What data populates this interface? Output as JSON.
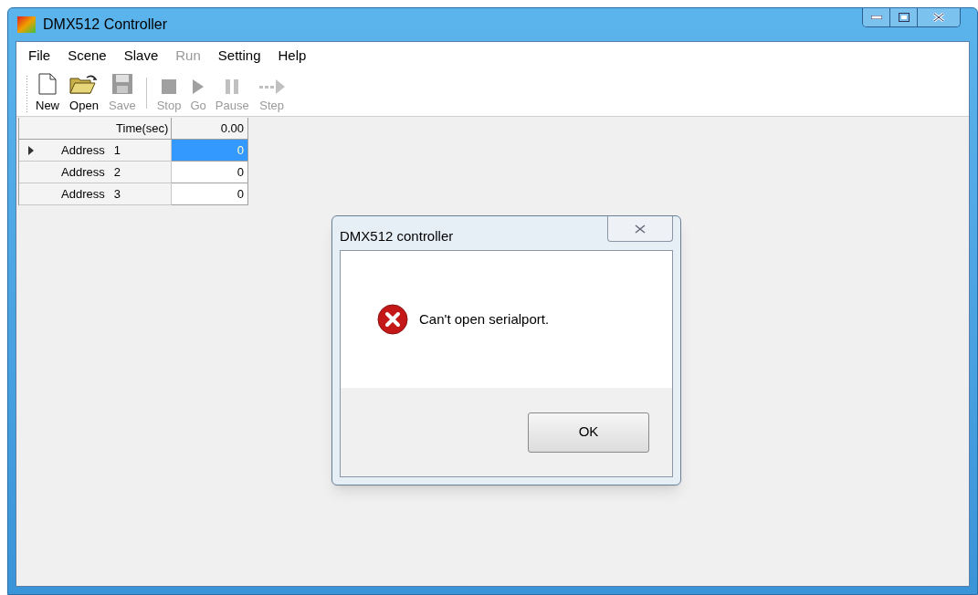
{
  "window": {
    "title": "DMX512 Controller"
  },
  "menu": [
    {
      "label": "File",
      "disabled": false
    },
    {
      "label": "Scene",
      "disabled": false
    },
    {
      "label": "Slave",
      "disabled": false
    },
    {
      "label": "Run",
      "disabled": true
    },
    {
      "label": "Setting",
      "disabled": false
    },
    {
      "label": "Help",
      "disabled": false
    }
  ],
  "toolbar": [
    {
      "kind": "new",
      "label": "New",
      "disabled": false
    },
    {
      "kind": "open",
      "label": "Open",
      "disabled": false
    },
    {
      "kind": "save",
      "label": "Save",
      "disabled": true
    },
    {
      "kind": "separator"
    },
    {
      "kind": "stop",
      "label": "Stop",
      "disabled": true
    },
    {
      "kind": "go",
      "label": "Go",
      "disabled": true
    },
    {
      "kind": "pause",
      "label": "Pause",
      "disabled": true
    },
    {
      "kind": "step",
      "label": "Step",
      "disabled": true
    }
  ],
  "grid": {
    "header": {
      "label": "Time(sec)",
      "value": "0.00"
    },
    "rows": [
      {
        "label": "Address",
        "number": "1",
        "value": "0",
        "selected": true
      },
      {
        "label": "Address",
        "number": "2",
        "value": "0",
        "selected": false
      },
      {
        "label": "Address",
        "number": "3",
        "value": "0",
        "selected": false
      }
    ]
  },
  "dialog": {
    "title": "DMX512 controller",
    "message": "Can't open serialport.",
    "button": "OK"
  }
}
